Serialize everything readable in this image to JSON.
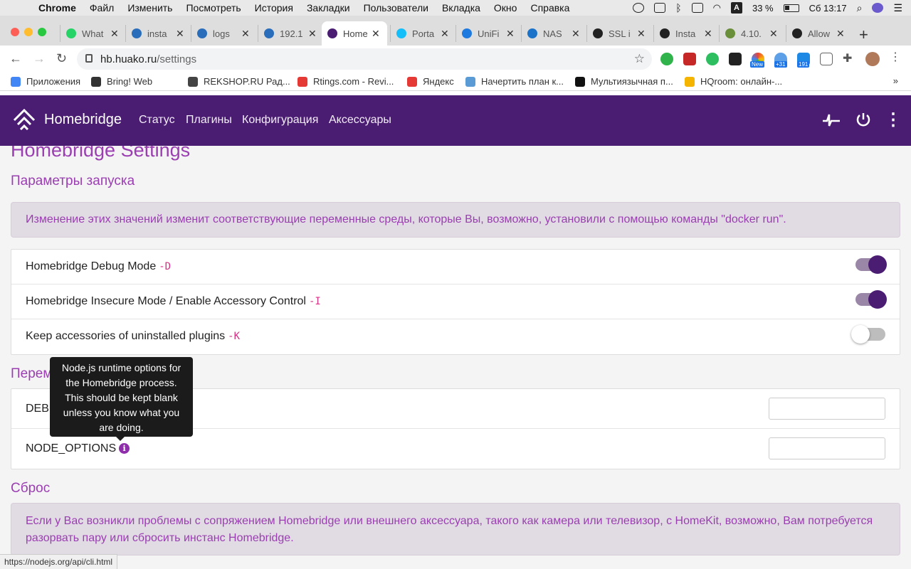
{
  "menubar": {
    "app": "Chrome",
    "items": [
      "Файл",
      "Изменить",
      "Посмотреть",
      "История",
      "Закладки",
      "Пользователи",
      "Вкладка",
      "Окно",
      "Справка"
    ],
    "battery": "33 %",
    "clock": "Сб 13:17",
    "input_source": "A"
  },
  "tabs": [
    {
      "label": "What",
      "color": "#25d366"
    },
    {
      "label": "insta",
      "color": "#2a6ebb"
    },
    {
      "label": "logs",
      "color": "#2a6ebb"
    },
    {
      "label": "192.1",
      "color": "#2a6ebb"
    },
    {
      "label": "Home",
      "color": "#4a1d72"
    },
    {
      "label": "Porta",
      "color": "#13bef9"
    },
    {
      "label": "UniFi",
      "color": "#1f7ae0"
    },
    {
      "label": "NAS",
      "color": "#1a73c8"
    },
    {
      "label": "SSL i",
      "color": "#222222"
    },
    {
      "label": "Insta",
      "color": "#222222"
    },
    {
      "label": "4.10.",
      "color": "#6a8f3a"
    },
    {
      "label": "Allow",
      "color": "#222222"
    }
  ],
  "active_tab_index": 4,
  "address": {
    "domain": "hb.huako.ru",
    "path": "/settings"
  },
  "extensions": {
    "badge_new": "New",
    "badge_31": "+31",
    "badge_191": "191"
  },
  "bookmarks": [
    {
      "label": "Приложения",
      "color": "#4285f4"
    },
    {
      "label": "Bring! Web",
      "color": "#333333"
    },
    {
      "label": "REKSHOP.RU Рад...",
      "color": "#444444"
    },
    {
      "label": "Rtings.com - Revi...",
      "color": "#e53935"
    },
    {
      "label": "Яндекс",
      "color": "#e53935"
    },
    {
      "label": "Начертить план к...",
      "color": "#5b9bd5"
    },
    {
      "label": "Мультиязычная п...",
      "color": "#111111"
    },
    {
      "label": "HQroom: онлайн-...",
      "color": "#f4b400"
    }
  ],
  "bookmarks_more": "»",
  "app": {
    "brand": "Homebridge",
    "nav": [
      "Статус",
      "Плагины",
      "Конфигурация",
      "Аксессуары"
    ],
    "accent": "#4a1d72"
  },
  "page": {
    "title": "Homebridge Settings",
    "launch_section": "Параметры запуска",
    "launch_alert": "Изменение этих значений изменит соответствующие переменные среды, которые Вы, возможно, установили с помощью команды \"docker run\".",
    "toggles": [
      {
        "label": "Homebridge Debug Mode",
        "flag": "-D",
        "on": true
      },
      {
        "label": "Homebridge Insecure Mode / Enable Accessory Control",
        "flag": "-I",
        "on": true
      },
      {
        "label": "Keep accessories of uninstalled plugins",
        "flag": "-K",
        "on": false
      }
    ],
    "env_section": "Переменные среды",
    "env_fields": [
      {
        "label": "DEBUG",
        "value": ""
      },
      {
        "label": "NODE_OPTIONS",
        "value": ""
      }
    ],
    "tooltip": "Node.js runtime options for the Homebridge process. This should be kept blank unless you know what you are doing.",
    "reset_section": "Сброс",
    "reset_alert": "Если у Вас возникли проблемы с сопряжением Homebridge или внешнего аксессуара, такого как камера или телевизор, с HomeKit, возможно, Вам потребуется разорвать пару или сбросить инстанс Homebridge."
  },
  "status_url": "https://nodejs.org/api/cli.html"
}
